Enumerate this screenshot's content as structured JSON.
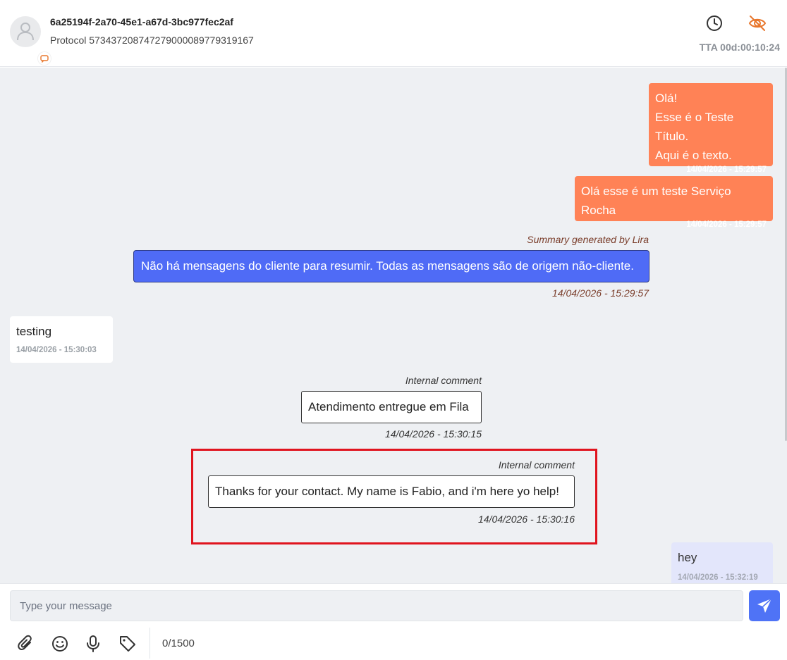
{
  "header": {
    "contact_id": "6a25194f-2a70-45e1-a67d-3bc977fec2af",
    "protocol": "Protocol 57343720874727900008977931916​7",
    "tta": "TTA 00d:00:10:24",
    "icons": [
      "avatar-user-icon",
      "chat-channel-icon",
      "clock-icon",
      "eye-off-icon"
    ],
    "accent_color": "#e8762c"
  },
  "messages": {
    "out1": {
      "lines": [
        "Olá!",
        "Esse é o Teste Título.",
        "Aqui é o texto."
      ],
      "time": "14/04/2026 - 15:29:57"
    },
    "out2": {
      "text": "Olá esse é um teste Serviço Rocha",
      "time": "14/04/2026 - 15:29:57"
    },
    "summary": {
      "label": "Summary generated by Lira",
      "text": "Não há mensagens do cliente para resumir. Todas as mensagens são de origem não-cliente.",
      "time": "14/04/2026 - 15:29:57"
    },
    "in1": {
      "text": "testing",
      "time": "14/04/2026 - 15:30:03"
    },
    "comment1": {
      "label": "Internal comment",
      "text": "Atendimento entregue em Fila",
      "time": "14/04/2026 - 15:30:15"
    },
    "comment2": {
      "label": "Internal comment",
      "text": "Thanks for your contact. My name is Fabio, and i'm here yo help!",
      "time": "14/04/2026 - 15:30:16"
    },
    "agent1": {
      "text": "hey",
      "time": "14/04/2026 - 15:32:19"
    }
  },
  "composer": {
    "placeholder": "Type your message",
    "counter": "0/1500",
    "tools": [
      "paperclip-icon",
      "emoji-icon",
      "microphone-icon",
      "tag-icon"
    ]
  },
  "colors": {
    "outgoing": "#ff8256",
    "summary": "#4f6bf6",
    "agent": "#e3e6fb",
    "highlight": "#e0141e",
    "send": "#4f73f6"
  }
}
